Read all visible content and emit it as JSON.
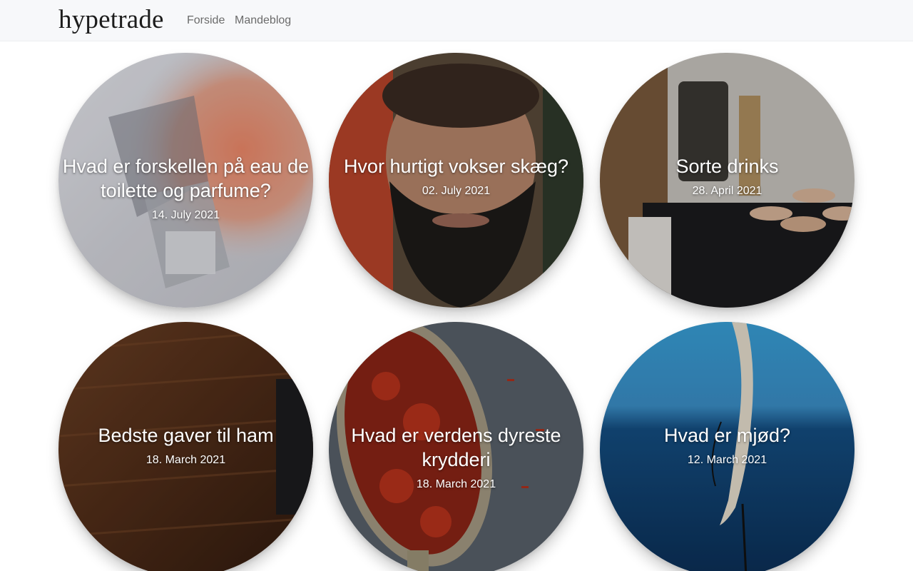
{
  "nav": {
    "logo_text": "hypetrade",
    "links": [
      "Forside",
      "Mandeblog"
    ]
  },
  "posts": [
    {
      "title": "Hvad er forskellen på eau de toilette og parfume?",
      "date": "14. July 2021",
      "image": "perfume-bottle-image"
    },
    {
      "title": "Hvor hurtigt vokser skæg?",
      "date": "02. July 2021",
      "image": "bearded-man-image"
    },
    {
      "title": "Sorte drinks",
      "date": "28. April 2021",
      "image": "cocktail-blender-image"
    },
    {
      "title": "Bedste gaver til ham",
      "date": "18. March 2021",
      "image": "wood-gift-box-image"
    },
    {
      "title": "Hvad er verdens dyreste krydderi",
      "date": "18. March 2021",
      "image": "saffron-spoon-image"
    },
    {
      "title": "Hvad er mjød?",
      "date": "12. March 2021",
      "image": "drinking-horn-sea-image"
    }
  ],
  "colors": {
    "navbar_bg": "#f7f8fa",
    "nav_link": "#6b6b6b",
    "card_text": "#ffffff"
  }
}
